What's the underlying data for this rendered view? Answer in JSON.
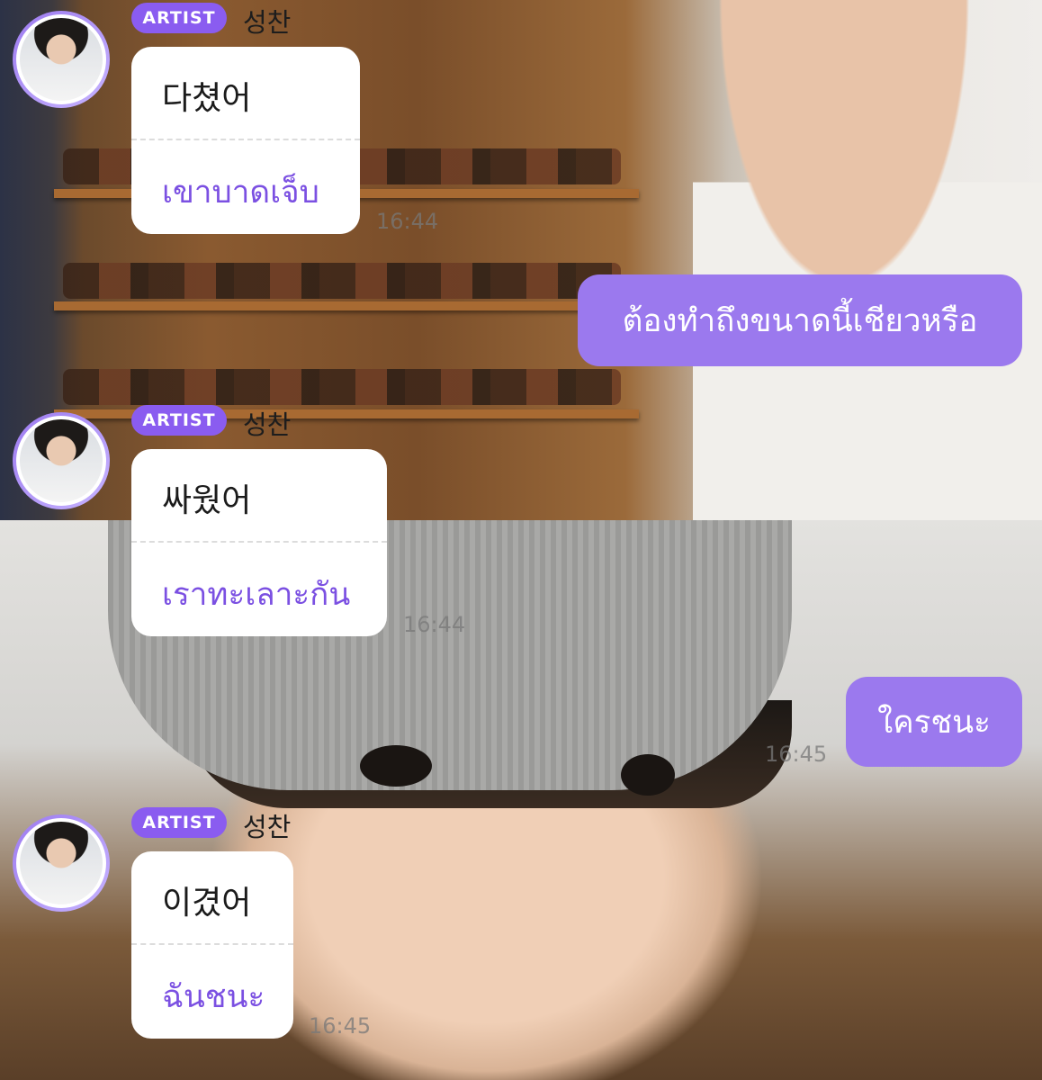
{
  "colors": {
    "accent": "#8a5cf0",
    "translation_text": "#7b50e2",
    "user_bubble": "#9b79ee",
    "artist_bubble": "#ffffff"
  },
  "messages": [
    {
      "type": "artist",
      "badge": "ARTIST",
      "sender": "성찬",
      "original": "다쳤어",
      "translation": "เขาบาดเจ็บ",
      "time": "16:44"
    },
    {
      "type": "user",
      "text": "ต้องทำถึงขนาดนี้เชียวหรือ"
    },
    {
      "type": "artist",
      "badge": "ARTIST",
      "sender": "성찬",
      "original": "싸웠어",
      "translation": "เราทะเลาะกัน",
      "time": "16:44"
    },
    {
      "type": "user",
      "text": "ใครชนะ",
      "time": "16:45"
    },
    {
      "type": "artist",
      "badge": "ARTIST",
      "sender": "성찬",
      "original": "이겼어",
      "translation": "ฉันชนะ",
      "time": "16:45"
    }
  ]
}
